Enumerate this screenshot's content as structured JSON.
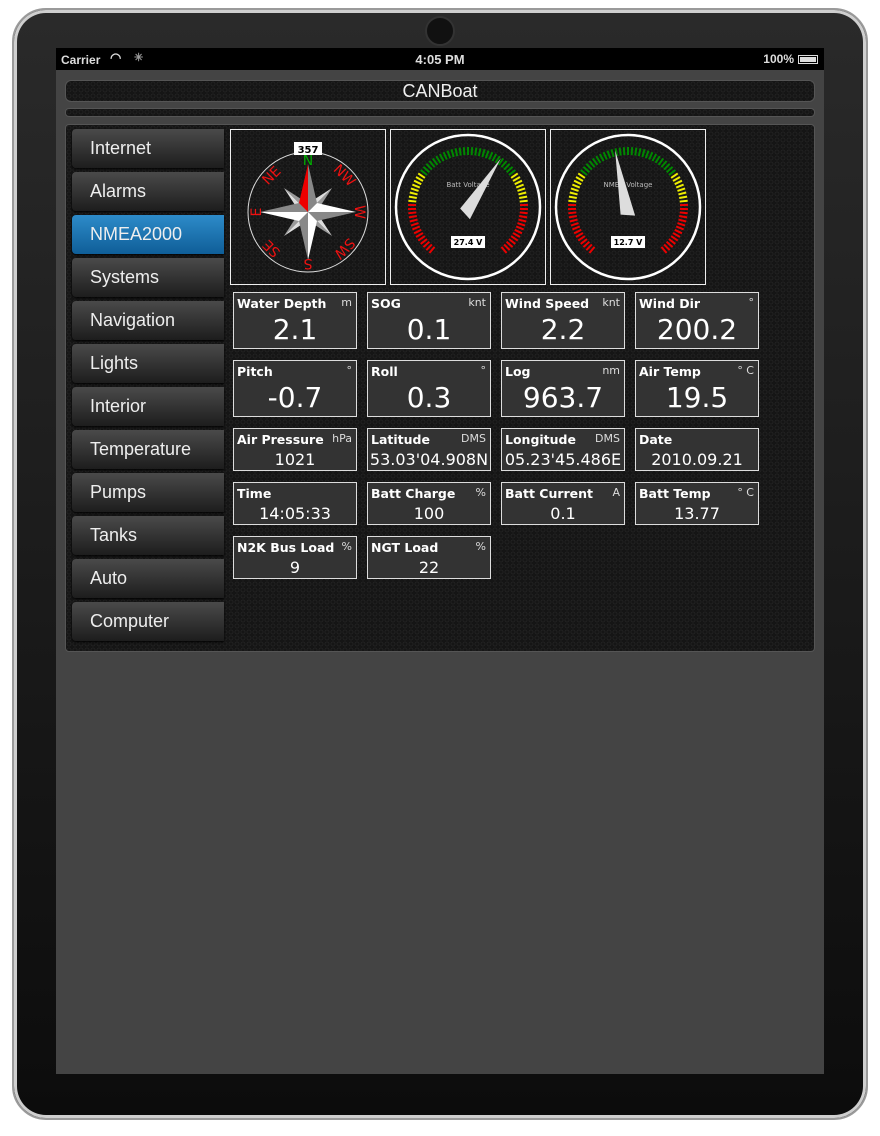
{
  "status_bar": {
    "carrier": "Carrier",
    "time": "4:05 PM",
    "battery": "100%"
  },
  "app": {
    "title": "CANBoat"
  },
  "sidebar": {
    "items": [
      {
        "label": "Internet",
        "active": false
      },
      {
        "label": "Alarms",
        "active": false
      },
      {
        "label": "NMEA2000",
        "active": true
      },
      {
        "label": "Systems",
        "active": false
      },
      {
        "label": "Navigation",
        "active": false
      },
      {
        "label": "Lights",
        "active": false
      },
      {
        "label": "Interior",
        "active": false
      },
      {
        "label": "Temperature",
        "active": false
      },
      {
        "label": "Pumps",
        "active": false
      },
      {
        "label": "Tanks",
        "active": false
      },
      {
        "label": "Auto",
        "active": false
      },
      {
        "label": "Computer",
        "active": false
      }
    ]
  },
  "compass": {
    "heading": "357",
    "labels": [
      "N",
      "NW",
      "W",
      "SW",
      "S",
      "SE",
      "E",
      "NE"
    ]
  },
  "gauges": [
    {
      "label": "Batt Voltage",
      "value": "27.4 V"
    },
    {
      "label": "NMEA Voltage",
      "value": "12.7 V"
    }
  ],
  "tiles": [
    {
      "label": "Water Depth",
      "unit": "m",
      "value": "2.1",
      "size": "big"
    },
    {
      "label": "SOG",
      "unit": "knt",
      "value": "0.1",
      "size": "big"
    },
    {
      "label": "Wind Speed",
      "unit": "knt",
      "value": "2.2",
      "size": "big"
    },
    {
      "label": "Wind Dir",
      "unit": "°",
      "value": "200.2",
      "size": "big"
    },
    {
      "label": "Pitch",
      "unit": "°",
      "value": "-0.7",
      "size": "big"
    },
    {
      "label": "Roll",
      "unit": "°",
      "value": "0.3",
      "size": "big"
    },
    {
      "label": "Log",
      "unit": "nm",
      "value": "963.7",
      "size": "big"
    },
    {
      "label": "Air Temp",
      "unit": "° C",
      "value": "19.5",
      "size": "big"
    },
    {
      "label": "Air Pressure",
      "unit": "hPa",
      "value": "1021",
      "size": "small"
    },
    {
      "label": "Latitude",
      "unit": "DMS",
      "value": "53.03'04.908N",
      "size": "small"
    },
    {
      "label": "Longitude",
      "unit": "DMS",
      "value": "05.23'45.486E",
      "size": "small"
    },
    {
      "label": "Date",
      "unit": "",
      "value": "2010.09.21",
      "size": "small"
    },
    {
      "label": "Time",
      "unit": "",
      "value": "14:05:33",
      "size": "small"
    },
    {
      "label": "Batt Charge",
      "unit": "%",
      "value": "100",
      "size": "small"
    },
    {
      "label": "Batt Current",
      "unit": "A",
      "value": "0.1",
      "size": "small"
    },
    {
      "label": "Batt Temp",
      "unit": "° C",
      "value": "13.77",
      "size": "small"
    },
    {
      "label": "N2K Bus Load",
      "unit": "%",
      "value": "9",
      "size": "small"
    },
    {
      "label": "NGT Load",
      "unit": "%",
      "value": "22",
      "size": "small"
    }
  ]
}
